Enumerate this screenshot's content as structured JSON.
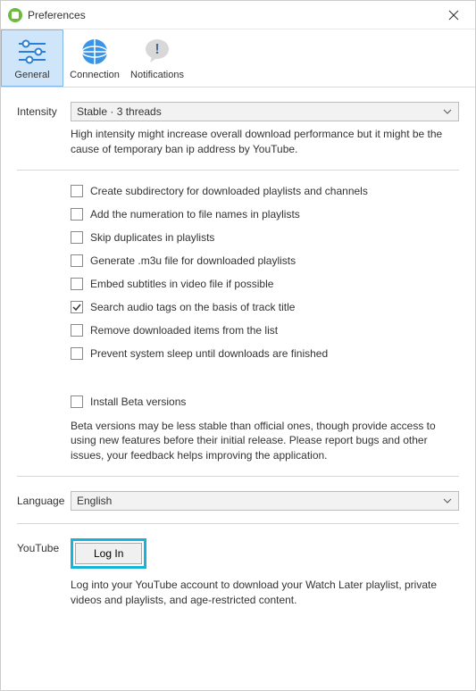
{
  "window": {
    "title": "Preferences"
  },
  "tabs": {
    "general": "General",
    "connection": "Connection",
    "notifications": "Notifications"
  },
  "intensity": {
    "label": "Intensity",
    "value": "Stable · 3 threads",
    "help": "High intensity might increase overall download performance but it might be the cause of temporary ban ip address by YouTube."
  },
  "options": [
    {
      "label": "Create subdirectory for downloaded playlists and channels",
      "checked": false
    },
    {
      "label": "Add the numeration to file names in playlists",
      "checked": false
    },
    {
      "label": "Skip duplicates in playlists",
      "checked": false
    },
    {
      "label": "Generate .m3u file for downloaded playlists",
      "checked": false
    },
    {
      "label": "Embed subtitles in video file if possible",
      "checked": false
    },
    {
      "label": "Search audio tags on the basis of track title",
      "checked": true
    },
    {
      "label": "Remove downloaded items from the list",
      "checked": false
    },
    {
      "label": "Prevent system sleep until downloads are finished",
      "checked": false
    }
  ],
  "beta": {
    "checkbox": "Install Beta versions",
    "checked": false,
    "help": "Beta versions may be less stable than official ones, though provide access to using new features before their initial release. Please report bugs and other issues, your feedback helps improving the application."
  },
  "language": {
    "label": "Language",
    "value": "English"
  },
  "youtube": {
    "label": "YouTube",
    "button": "Log In",
    "help": "Log into your YouTube account to download your Watch Later playlist, private videos and playlists, and age-restricted content."
  }
}
